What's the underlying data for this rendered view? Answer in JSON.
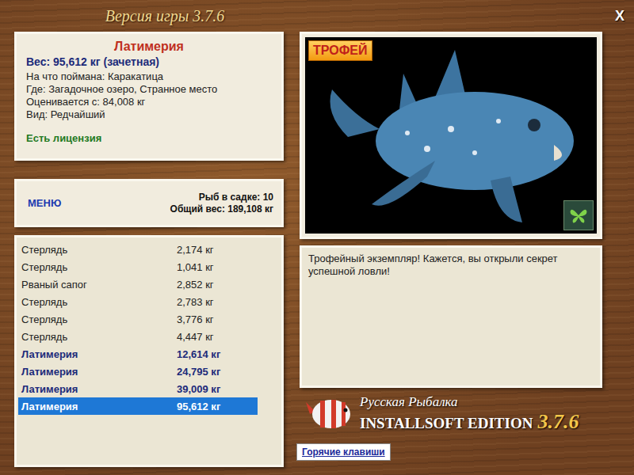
{
  "window": {
    "title": "Версия игры 3.7.6",
    "close": "X"
  },
  "catch": {
    "name": "Латимерия",
    "weight": "Вес: 95,612 кг (зачетная)",
    "details": [
      "На что поймана: Каракатица",
      "Где: Загадочное озеро, Странное место",
      "Оценивается с: 84,008 кг",
      "Вид: Редчайший"
    ],
    "license": "Есть лицензия"
  },
  "menu": {
    "label": "МЕНЮ",
    "count": "Рыб в садке: 10",
    "total": "Общий вес: 189,108 кг"
  },
  "catches": [
    {
      "name": "Стерлядь",
      "weight": "2,174 кг",
      "trophy": false,
      "selected": false
    },
    {
      "name": "Стерлядь",
      "weight": "1,041 кг",
      "trophy": false,
      "selected": false
    },
    {
      "name": "Рваный сапог",
      "weight": "2,852 кг",
      "trophy": false,
      "selected": false
    },
    {
      "name": "Стерлядь",
      "weight": "2,783 кг",
      "trophy": false,
      "selected": false
    },
    {
      "name": "Стерлядь",
      "weight": "3,776 кг",
      "trophy": false,
      "selected": false
    },
    {
      "name": "Стерлядь",
      "weight": "4,447 кг",
      "trophy": false,
      "selected": false
    },
    {
      "name": "Латимерия",
      "weight": "12,614 кг",
      "trophy": true,
      "selected": false
    },
    {
      "name": "Латимерия",
      "weight": "24,795 кг",
      "trophy": true,
      "selected": false
    },
    {
      "name": "Латимерия",
      "weight": "39,009 кг",
      "trophy": true,
      "selected": false
    },
    {
      "name": "Латимерия",
      "weight": "95,612 кг",
      "trophy": true,
      "selected": true
    }
  ],
  "picture": {
    "badge": "ТРОФЕЙ"
  },
  "message": "Трофейный экземпляр! Кажется, вы открыли секрет успешной ловли!",
  "logo": {
    "title": "Русская Рыбалка",
    "edition": "INSTALLSOFT EDITION",
    "version": "3.7.6"
  },
  "hotkeys": "Горячие клавиши"
}
